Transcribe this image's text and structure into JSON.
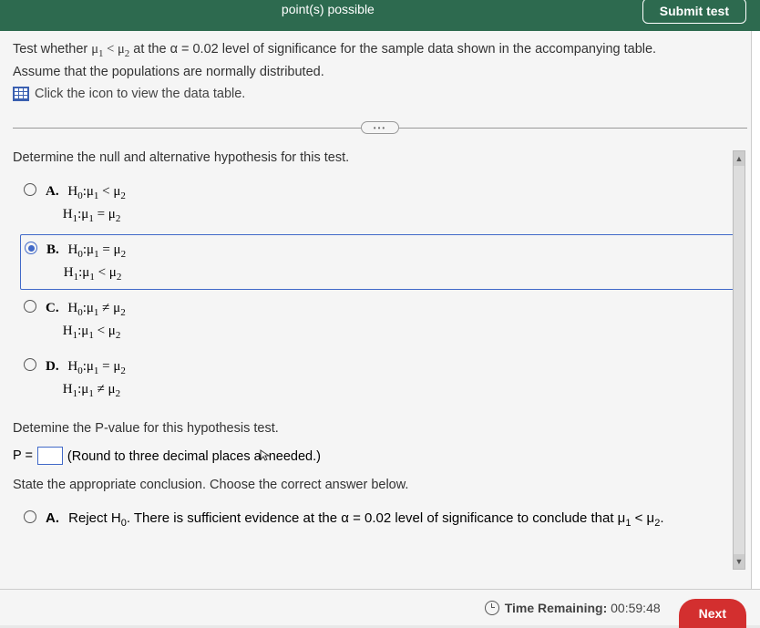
{
  "header": {
    "points_label": "point(s) possible",
    "submit_label": "Submit test"
  },
  "question": {
    "line1_prefix": "Test whether ",
    "line1_math": "μ₁ < μ₂",
    "line1_mid": " at the α = 0.02 level of significance for the sample data shown in the accompanying table.",
    "line2": "Assume that the populations are normally distributed.",
    "link_text": "Click the icon to view the data table."
  },
  "part1": {
    "instruction": "Determine the null and alternative hypothesis for this test.",
    "options": [
      {
        "letter": "A.",
        "h0_prefix": "H",
        "h0_sub": "0",
        "h0_sep": ":",
        "h0_l": "μ",
        "h0_lsub": "1",
        "h0_op": " < ",
        "h0_r": "μ",
        "h0_rsub": "2",
        "h1_prefix": "H",
        "h1_sub": "1",
        "h1_sep": ":",
        "h1_l": "μ",
        "h1_lsub": "1",
        "h1_op": " = ",
        "h1_r": "μ",
        "h1_rsub": "2"
      },
      {
        "letter": "B.",
        "h0_prefix": "H",
        "h0_sub": "0",
        "h0_sep": ":",
        "h0_l": "μ",
        "h0_lsub": "1",
        "h0_op": " = ",
        "h0_r": "μ",
        "h0_rsub": "2",
        "h1_prefix": "H",
        "h1_sub": "1",
        "h1_sep": ":",
        "h1_l": "μ",
        "h1_lsub": "1",
        "h1_op": " < ",
        "h1_r": "μ",
        "h1_rsub": "2"
      },
      {
        "letter": "C.",
        "h0_prefix": "H",
        "h0_sub": "0",
        "h0_sep": ":",
        "h0_l": "μ",
        "h0_lsub": "1",
        "h0_op": " ≠ ",
        "h0_r": "μ",
        "h0_rsub": "2",
        "h1_prefix": "H",
        "h1_sub": "1",
        "h1_sep": ":",
        "h1_l": "μ",
        "h1_lsub": "1",
        "h1_op": " < ",
        "h1_r": "μ",
        "h1_rsub": "2"
      },
      {
        "letter": "D.",
        "h0_prefix": "H",
        "h0_sub": "0",
        "h0_sep": ":",
        "h0_l": "μ",
        "h0_lsub": "1",
        "h0_op": " = ",
        "h0_r": "μ",
        "h0_rsub": "2",
        "h1_prefix": "H",
        "h1_sub": "1",
        "h1_sep": ":",
        "h1_l": "μ",
        "h1_lsub": "1",
        "h1_op": " ≠ ",
        "h1_r": "μ",
        "h1_rsub": "2"
      }
    ],
    "selected_index": 1
  },
  "part2": {
    "instruction": "Detemine the P-value for this hypothesis test.",
    "p_label": "P =",
    "hint": "(Round to three decimal places as needed.)"
  },
  "part3": {
    "instruction": "State the appropriate conclusion. Choose the correct answer below.",
    "options": [
      {
        "letter": "A.",
        "text_prefix": "Reject H",
        "text_sub": "0",
        "text_rest": ". There is sufficient evidence at the α = 0.02 level of significance to conclude that μ",
        "text_sub2": "1",
        "text_mid": " < μ",
        "text_sub3": "2",
        "text_end": "."
      }
    ]
  },
  "footer": {
    "timer_label": "Time Remaining:",
    "timer_value": "00:59:48",
    "next_label": "Next"
  }
}
